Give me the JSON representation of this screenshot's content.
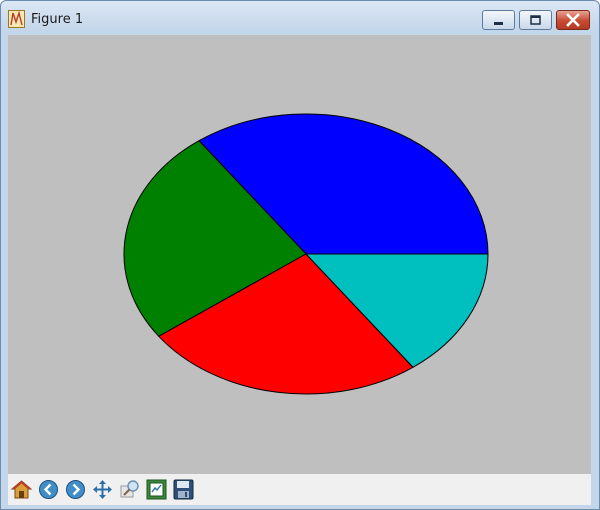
{
  "window": {
    "title": "Figure 1",
    "app_icon": "matplotlib-figure-icon",
    "controls": [
      "minimize-icon",
      "maximize-icon",
      "close-icon"
    ]
  },
  "colors": {
    "axes_background": "#bfbfbf",
    "toolbar_background": "#f0f0f0",
    "close_button": "#c74a32"
  },
  "toolbar": {
    "buttons": [
      {
        "name": "home-icon"
      },
      {
        "name": "back-icon"
      },
      {
        "name": "forward-icon"
      },
      {
        "name": "pan-icon"
      },
      {
        "name": "zoom-icon"
      },
      {
        "name": "subplots-configure-icon"
      },
      {
        "name": "save-icon"
      }
    ]
  },
  "chart_data": {
    "type": "pie",
    "title": "",
    "start_angle_deg": 0,
    "direction": "counterclockwise",
    "legend": "none",
    "slices": [
      {
        "value": 0.35,
        "color": "#0000ff"
      },
      {
        "value": 0.25,
        "color": "#008000"
      },
      {
        "value": 0.25,
        "color": "#ff0000"
      },
      {
        "value": 0.15,
        "color": "#00bfbf"
      }
    ]
  }
}
